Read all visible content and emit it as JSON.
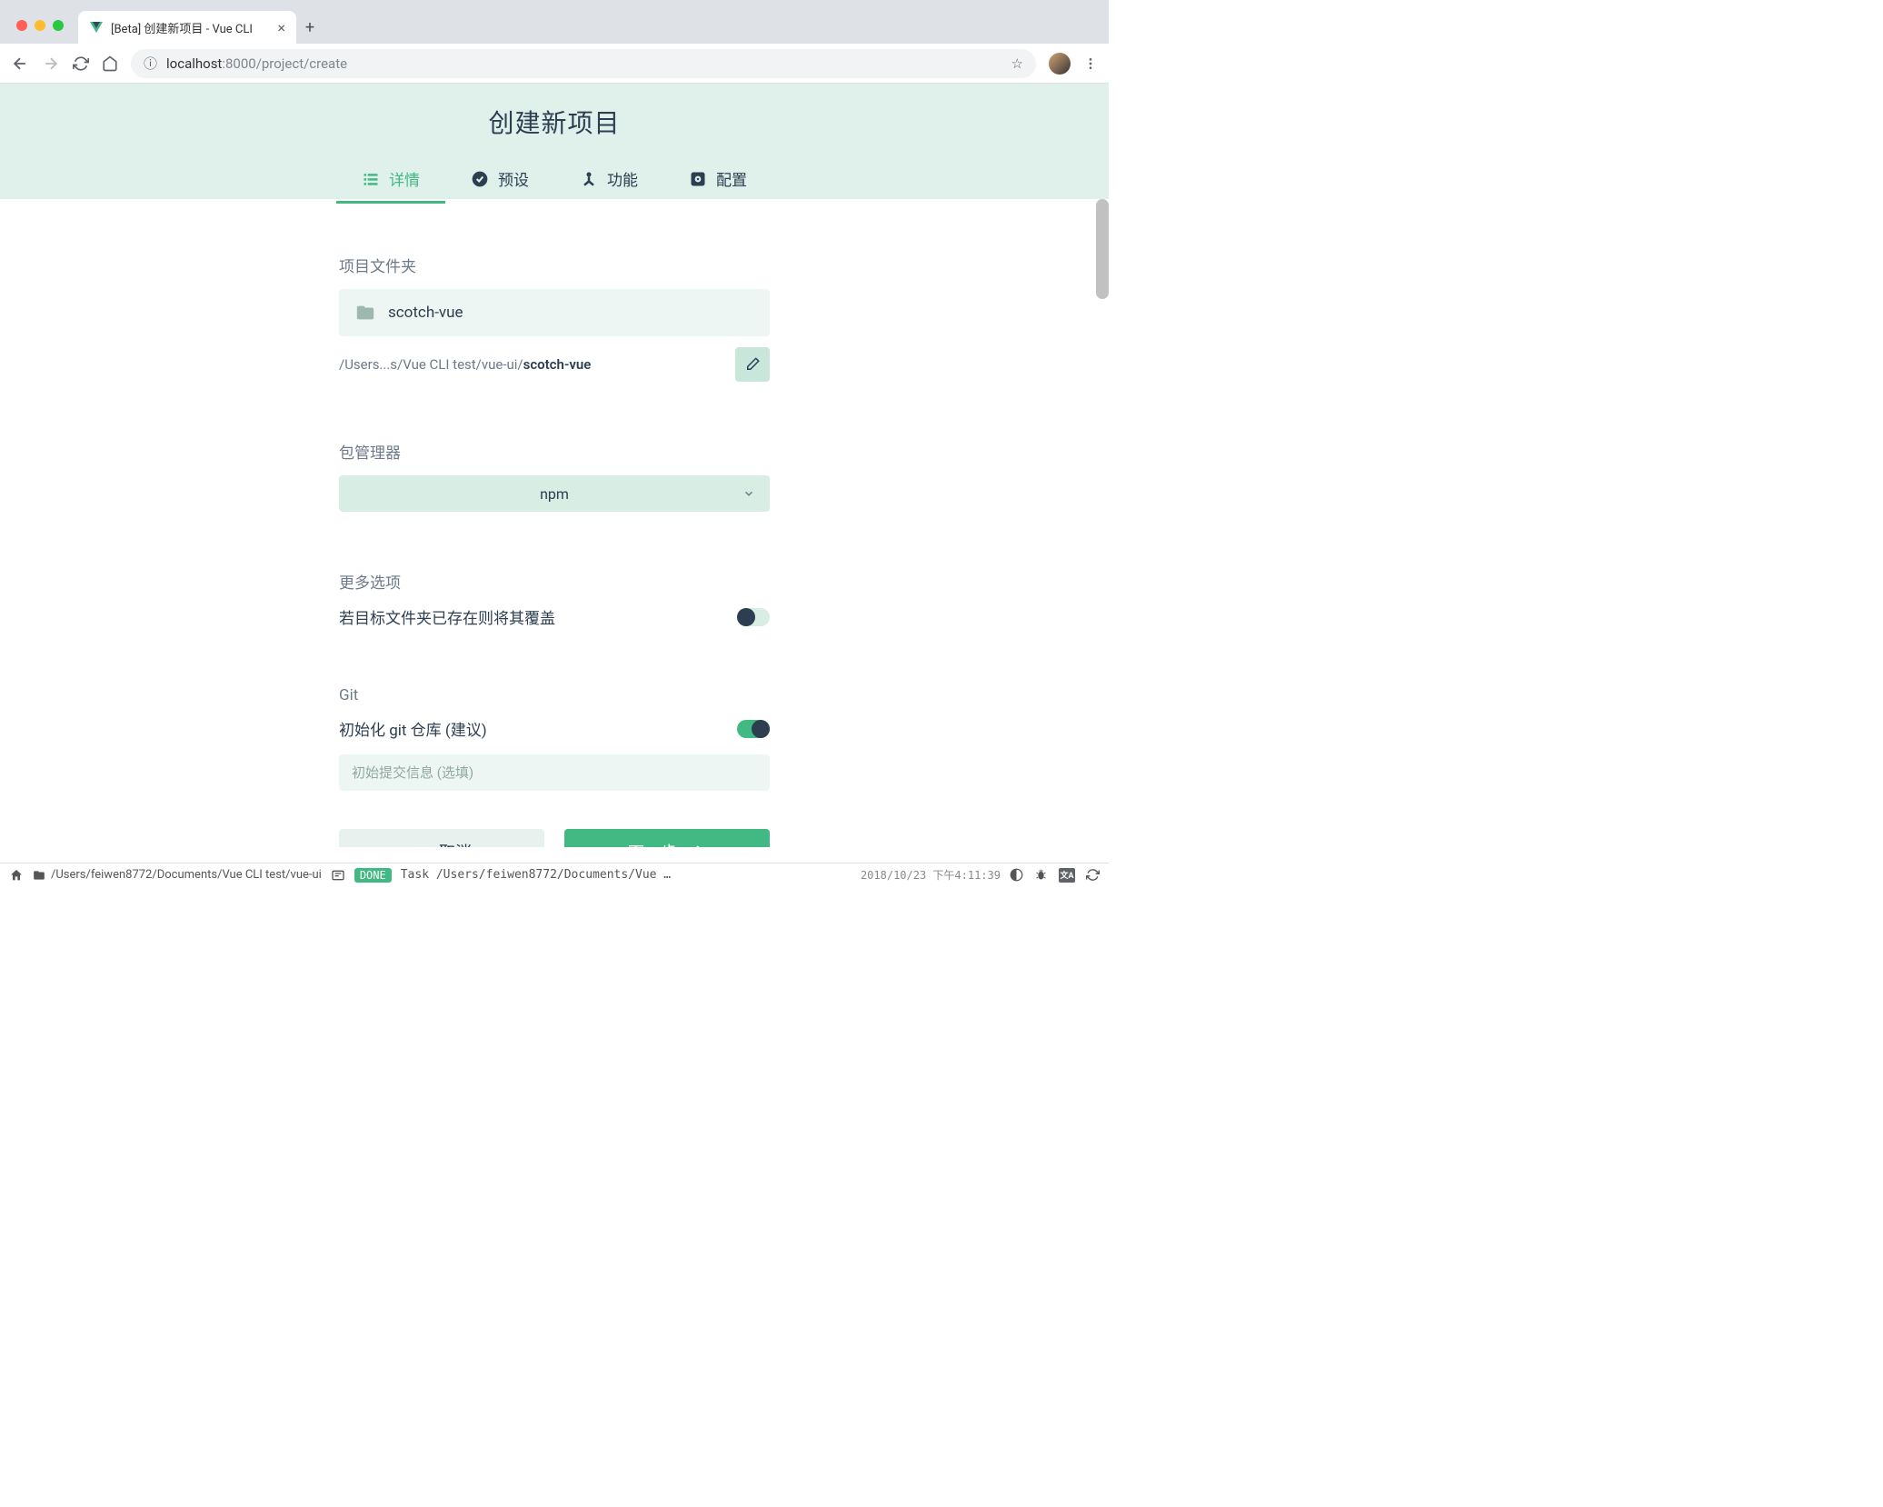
{
  "browser": {
    "tab_title": "[Beta] 创建新项目 - Vue CLI",
    "url_host": "localhost",
    "url_port_path": ":8000/project/create"
  },
  "header": {
    "title": "创建新项目",
    "tabs": [
      {
        "label": "详情",
        "icon": "list-icon"
      },
      {
        "label": "预设",
        "icon": "check-circle-icon"
      },
      {
        "label": "功能",
        "icon": "plugin-icon"
      },
      {
        "label": "配置",
        "icon": "gear-icon"
      }
    ]
  },
  "form": {
    "folder_label": "项目文件夹",
    "folder_value": "scotch-vue",
    "path_prefix": "/Users...s/Vue CLI test/vue-ui/",
    "path_bold": "scotch-vue",
    "pm_label": "包管理器",
    "pm_value": "npm",
    "more_label": "更多选项",
    "overwrite_label": "若目标文件夹已存在则将其覆盖",
    "overwrite_on": false,
    "git_label": "Git",
    "git_init_label": "初始化 git 仓库 (建议)",
    "git_init_on": true,
    "git_commit_placeholder": "初始提交信息 (选填)"
  },
  "buttons": {
    "cancel": "取消",
    "next": "下一步"
  },
  "status": {
    "path": "/Users/feiwen8772/Documents/Vue CLI test/vue-ui",
    "done": "DONE",
    "task": "Task /Users/feiwen8772/Documents/Vue …",
    "time": "2018/10/23 下午4:11:39"
  }
}
